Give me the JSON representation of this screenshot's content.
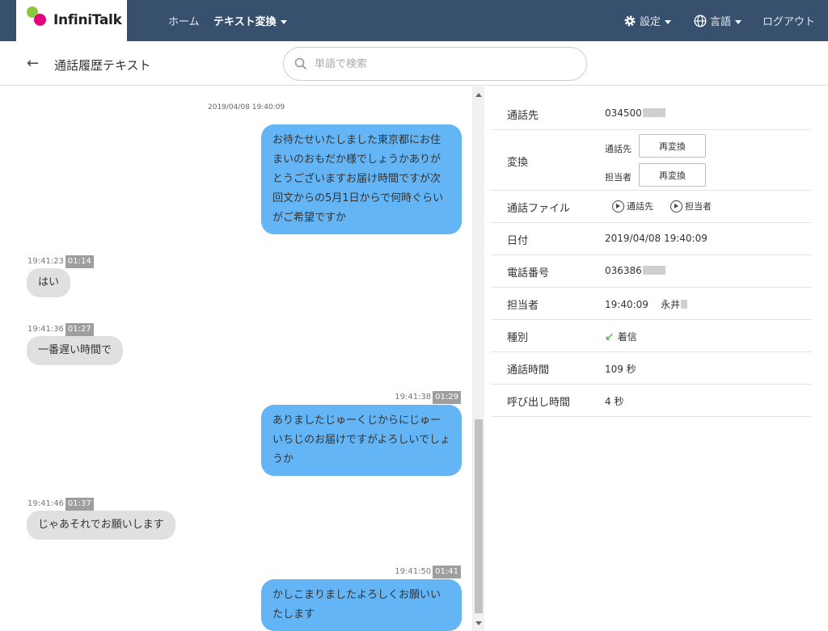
{
  "app": {
    "logo_text": "InfiniTalk"
  },
  "nav": {
    "home": "ホーム",
    "text_convert": "テキスト変換",
    "settings": "設定",
    "language": "言語",
    "logout": "ログアウト"
  },
  "header": {
    "title": "通話履歴テキスト"
  },
  "search": {
    "placeholder": "単語で検索"
  },
  "chat": {
    "date": "2019/04/08 19:40:09",
    "messages": [
      {
        "side": "agent",
        "time": "",
        "offset": "",
        "text": "お待たせいたしました東京都にお住まいのおもだか様でしょうかありがとうございますお届け時間ですが次回文からの5月1日からで何時ぐらいがご希望ですか"
      },
      {
        "side": "customer",
        "time": "19:41:23",
        "offset": "01:14",
        "text": "はい"
      },
      {
        "side": "customer",
        "time": "19:41:36",
        "offset": "01:27",
        "text": "一番遅い時間で"
      },
      {
        "side": "agent",
        "time": "19:41:38",
        "offset": "01:29",
        "text": "ありましたじゅーくじからにじゅーいちじのお届けですがよろしいでしょうか"
      },
      {
        "side": "customer",
        "time": "19:41:46",
        "offset": "01:37",
        "text": "じゃあそれでお願いします"
      },
      {
        "side": "agent",
        "time": "19:41:50",
        "offset": "01:41",
        "text": "かしこまりましたよろしくお願いいたします"
      }
    ]
  },
  "details": {
    "callee_label": "通話先",
    "callee_value": "034500",
    "convert_label": "変換",
    "convert_callee_label": "通話先",
    "convert_agent_label": "担当者",
    "reconvert_button": "再変換",
    "file_label": "通話ファイル",
    "file_callee": "通話先",
    "file_agent": "担当者",
    "date_label": "日付",
    "date_value": "2019/04/08 19:40:09",
    "phone_label": "電話番号",
    "phone_value": "036386",
    "agent_label": "担当者",
    "agent_time": "19:40:09",
    "agent_name": "永井",
    "type_label": "種別",
    "type_value": "着信",
    "duration_label": "通話時間",
    "duration_value": "109 秒",
    "ring_label": "呼び出し時間",
    "ring_value": "4 秒"
  },
  "colors": {
    "topbar": "#37506e",
    "agent_bubble": "#64b5f6",
    "customer_bubble": "#e0e0e0",
    "incoming": "#43a047"
  }
}
